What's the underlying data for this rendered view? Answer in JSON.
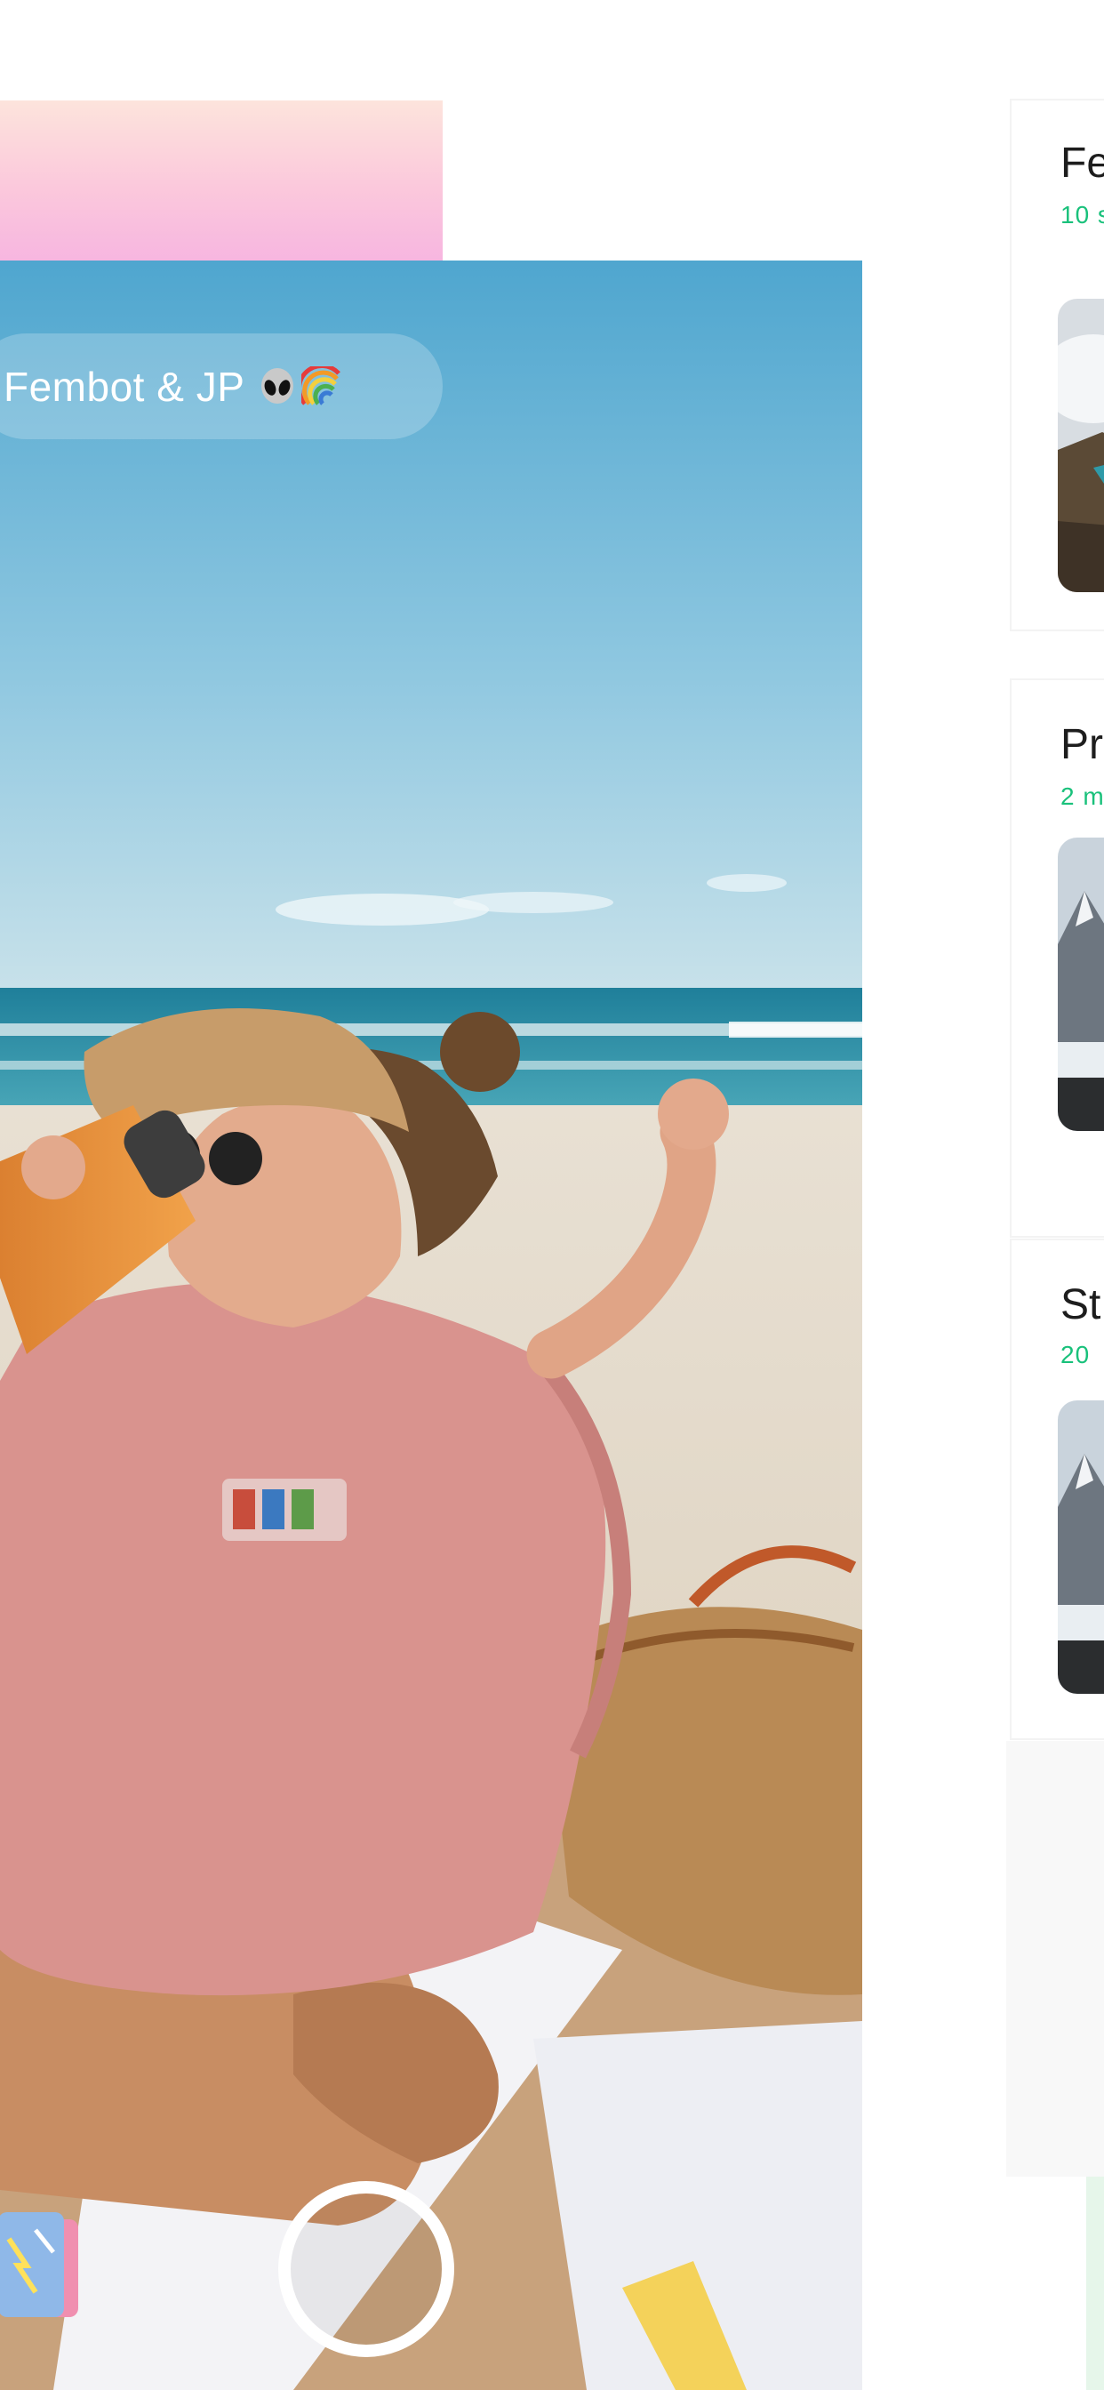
{
  "album": {
    "title": "Fembot & JP",
    "emoji": [
      "alien-icon",
      "alien-icon",
      "rainbow-icon"
    ]
  },
  "camera": {
    "shutter": "shutter-button",
    "gallery": "gallery-thumbnail"
  },
  "albums_list": [
    {
      "title": "Fe",
      "subtitle": "10 s"
    },
    {
      "title": "Pr",
      "subtitle": "2 m"
    },
    {
      "title": "St",
      "subtitle": "20"
    }
  ],
  "colors": {
    "accent_green": "#19c17b",
    "pink_gradient_top": "#fde4dc",
    "pink_gradient_bottom": "#f7b6e0"
  }
}
